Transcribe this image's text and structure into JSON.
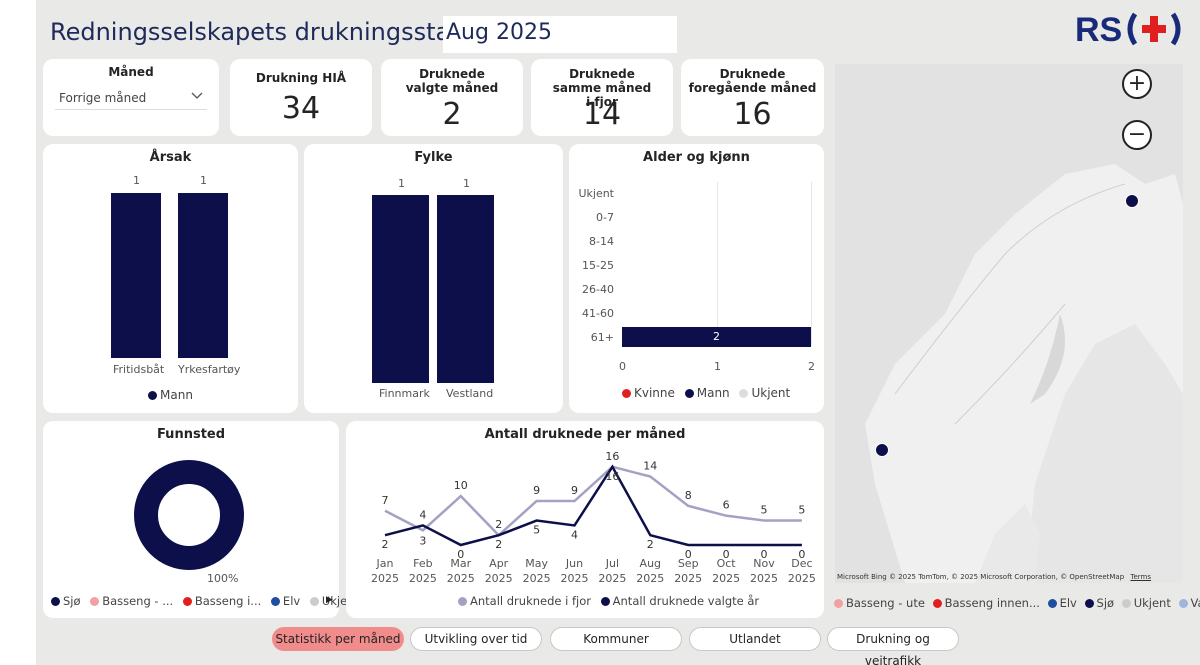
{
  "header": {
    "title": "Redningsselskapets drukningsstatistikk",
    "selected_month": "Aug 2025",
    "logo_text": "RS"
  },
  "slicer": {
    "label": "Måned",
    "value": "Forrige måned"
  },
  "kpis": [
    {
      "label": "Drukning HIÅ",
      "value": "34"
    },
    {
      "label": "Druknede valgte måned",
      "value": "2"
    },
    {
      "label": "Druknede samme måned i fjor",
      "value": "14"
    },
    {
      "label": "Druknede foregående måned",
      "value": "16"
    }
  ],
  "arsak": {
    "title": "Årsak",
    "categories": [
      "Fritidsbåt",
      "Yrkesfartøy"
    ],
    "values": [
      1,
      1
    ],
    "value_labels": [
      "1",
      "1"
    ],
    "legend": [
      "Mann"
    ]
  },
  "fylke": {
    "title": "Fylke",
    "categories": [
      "Finnmark",
      "Vestland"
    ],
    "values": [
      1,
      1
    ],
    "value_labels": [
      "1",
      "1"
    ]
  },
  "alder": {
    "title": "Alder og kjønn",
    "categories": [
      "Ukjent",
      "0-7",
      "8-14",
      "15-25",
      "26-40",
      "41-60",
      "61+"
    ],
    "values": [
      0,
      0,
      0,
      0,
      0,
      0,
      2
    ],
    "bar_label": "2",
    "xticks": [
      "0",
      "1",
      "2"
    ],
    "legend": [
      "Kvinne",
      "Mann",
      "Ukjent"
    ]
  },
  "funnsted": {
    "title": "Funnsted",
    "pct_label": "100%",
    "legend": [
      "Sjø",
      "Basseng - ...",
      "Basseng i...",
      "Elv",
      "Ukjent"
    ]
  },
  "chart_data": {
    "type": "line",
    "title": "Antall druknede per måned",
    "categories": [
      "Jan 2025",
      "Feb 2025",
      "Mar 2025",
      "Apr 2025",
      "May 2025",
      "Jun 2025",
      "Jul 2025",
      "Aug 2025",
      "Sep 2025",
      "Oct 2025",
      "Nov 2025",
      "Dec 2025"
    ],
    "month_labels": [
      "Jan",
      "Feb",
      "Mar",
      "Apr",
      "May",
      "Jun",
      "Jul",
      "Aug",
      "Sep",
      "Oct",
      "Nov",
      "Dec"
    ],
    "year_label": "2025",
    "series": [
      {
        "name": "Antall druknede i fjor",
        "values": [
          7,
          3,
          10,
          2,
          9,
          9,
          16,
          14,
          8,
          6,
          5,
          5
        ],
        "color": "#a3a1c4"
      },
      {
        "name": "Antall druknede valgte år",
        "values": [
          2,
          4,
          0,
          2,
          5,
          4,
          16,
          2,
          0,
          0,
          0,
          0
        ],
        "color": "#0d0f4a"
      }
    ],
    "ylim": [
      0,
      18
    ]
  },
  "map": {
    "legend": [
      "Basseng - ute",
      "Basseng innen...",
      "Elv",
      "Sjø",
      "Ukjent",
      "Vann"
    ],
    "attribution": "© 2025 TomTom, © 2025 Microsoft Corporation, © OpenStreetMap",
    "terms": "Terms",
    "bing": "Microsoft Bing",
    "zoom_in": "+",
    "zoom_out": "−"
  },
  "nav": [
    "Statistikk per måned",
    "Utvikling over tid",
    "Kommuner",
    "Utlandet",
    "Drukning og veitrafikk"
  ],
  "colors": {
    "navy": "#0d0f4a",
    "lavender": "#a3a1c4",
    "red": "#e02020",
    "pink": "#f08c8c",
    "blue": "#1f4ea0",
    "gray": "#d0d0d0"
  }
}
